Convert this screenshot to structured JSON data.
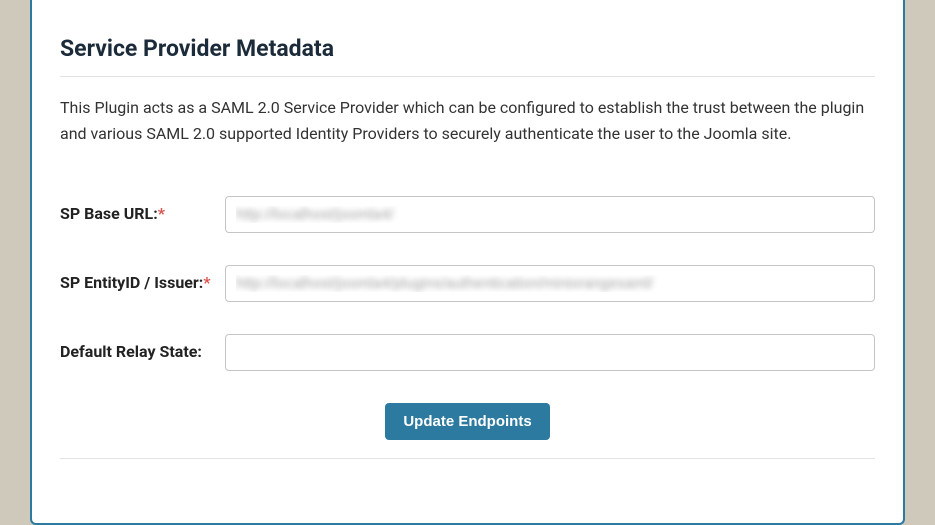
{
  "panel": {
    "title": "Service Provider Metadata",
    "description": "This Plugin acts as a SAML 2.0 Service Provider which can be configured to establish the trust between the plugin and various SAML 2.0 supported Identity Providers to securely authenticate the user to the Joomla site."
  },
  "form": {
    "sp_base_url": {
      "label": "SP Base URL:",
      "required": "*",
      "value": "http://localhost/joomla4/"
    },
    "sp_entity_id": {
      "label": "SP EntityID / Issuer:",
      "required": "*",
      "value": "http://localhost/joomla4/plugins/authentication/miniorangesaml/"
    },
    "relay_state": {
      "label": "Default Relay State:",
      "value": ""
    }
  },
  "button": {
    "update_label": "Update Endpoints"
  }
}
